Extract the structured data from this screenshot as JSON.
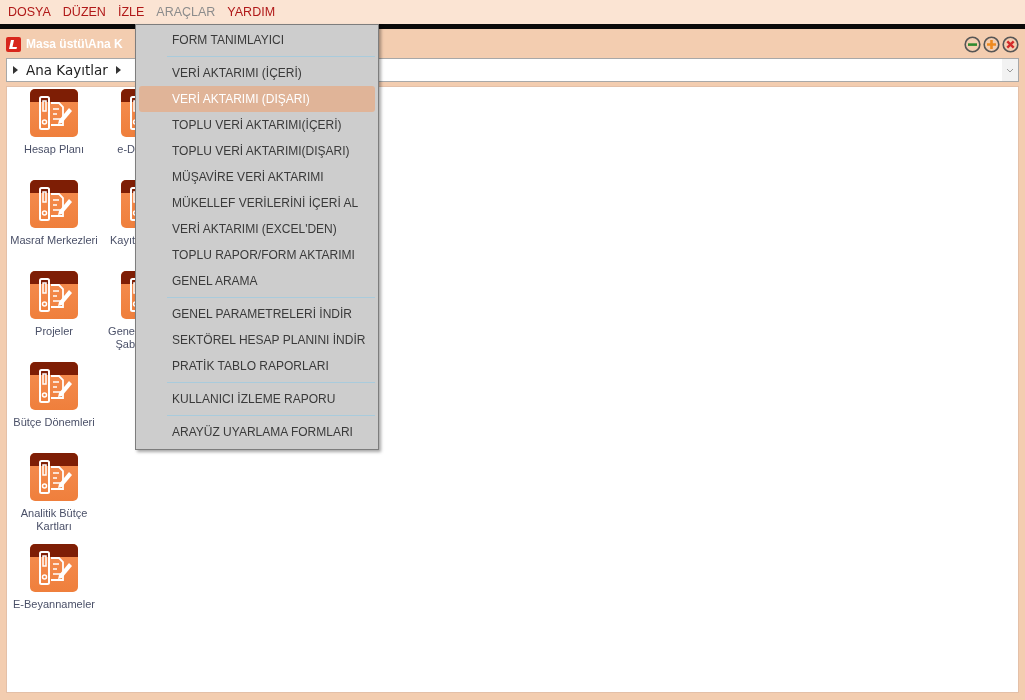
{
  "menubar": [
    {
      "label": "DOSYA",
      "open": false
    },
    {
      "label": "DÜZEN",
      "open": false
    },
    {
      "label": "İZLE",
      "open": false
    },
    {
      "label": "ARAÇLAR",
      "open": true
    },
    {
      "label": "YARDIM",
      "open": false
    }
  ],
  "window": {
    "title": "Masa üstü\\Ana K",
    "breadcrumb": "Ana Kayıtlar"
  },
  "columns": [
    [
      {
        "label": "Hesap Planı"
      },
      {
        "label": "Masraf Merkezleri"
      },
      {
        "label": "Projeler"
      },
      {
        "label": "Bütçe Dönemleri"
      },
      {
        "label": "Analitik Bütçe Kartları"
      },
      {
        "label": "E-Beyannameler"
      }
    ],
    [
      {
        "label": "e-D"
      },
      {
        "label": "Kayıt"
      },
      {
        "label": "Gene\nŞab"
      }
    ]
  ],
  "menu": [
    {
      "kind": "item",
      "label": "FORM TANIMLAYICI",
      "selected": false
    },
    {
      "kind": "separator"
    },
    {
      "kind": "item",
      "label": "VERİ AKTARIMI (İÇERİ)",
      "selected": false
    },
    {
      "kind": "item",
      "label": "VERİ AKTARIMI (DIŞARI)",
      "selected": true
    },
    {
      "kind": "item",
      "label": "TOPLU VERİ AKTARIMI(İÇERİ)",
      "selected": false
    },
    {
      "kind": "item",
      "label": "TOPLU VERİ AKTARIMI(DIŞARI)",
      "selected": false
    },
    {
      "kind": "item",
      "label": "MÜŞAVİRE VERİ AKTARIMI",
      "selected": false
    },
    {
      "kind": "item",
      "label": "MÜKELLEF VERİLERİNİ İÇERİ AL",
      "selected": false
    },
    {
      "kind": "item",
      "label": "VERİ AKTARIMI (EXCEL'DEN)",
      "selected": false
    },
    {
      "kind": "item",
      "label": "TOPLU RAPOR/FORM AKTARIMI",
      "selected": false
    },
    {
      "kind": "item",
      "label": "GENEL ARAMA",
      "selected": false
    },
    {
      "kind": "separator"
    },
    {
      "kind": "item",
      "label": "GENEL PARAMETRELERİ İNDİR",
      "selected": false
    },
    {
      "kind": "item",
      "label": "SEKTÖREL HESAP PLANINI İNDİR",
      "selected": false
    },
    {
      "kind": "item",
      "label": "PRATİK TABLO RAPORLARI",
      "selected": false
    },
    {
      "kind": "separator"
    },
    {
      "kind": "item",
      "label": "KULLANICI İZLEME RAPORU",
      "selected": false
    },
    {
      "kind": "separator"
    },
    {
      "kind": "item",
      "label": "ARAYÜZ UYARLAMA FORMLARI",
      "selected": false
    }
  ]
}
